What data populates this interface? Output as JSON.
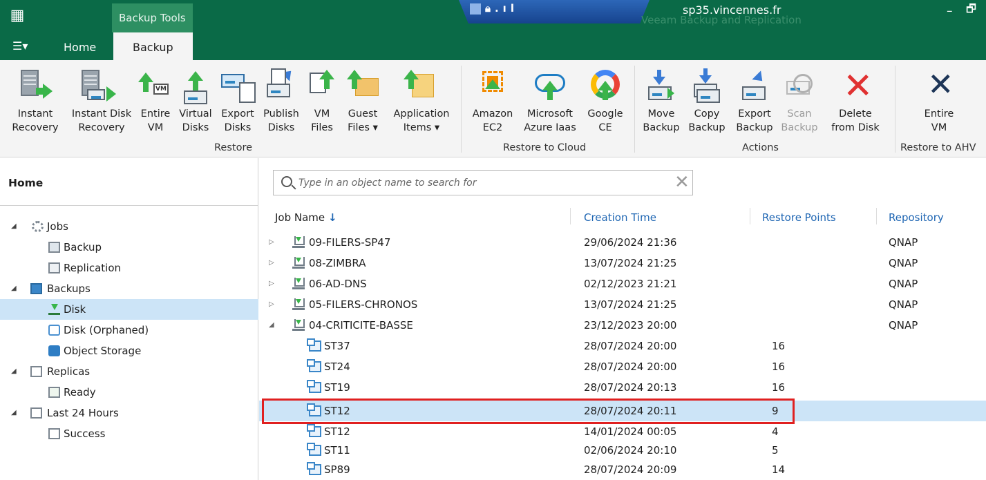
{
  "titlebar": {
    "contextual_tab": "Backup Tools",
    "ghost_title": "Veeam Backup and Replication",
    "server": "sp35.vincennes.fr",
    "minimize": "–",
    "restore": "🗗"
  },
  "tabs": {
    "menu": "☰▾",
    "home": "Home",
    "backup": "Backup"
  },
  "ribbon": {
    "buttons": [
      {
        "label": "Instant\nRecovery",
        "icon": "server-arrow-icon"
      },
      {
        "label": "Instant Disk\nRecovery",
        "icon": "server-disk-arrow-icon"
      },
      {
        "label": "Entire\nVM",
        "icon": "vm-restore-icon"
      },
      {
        "label": "Virtual\nDisks",
        "icon": "virtual-disk-restore-icon"
      },
      {
        "label": "Export\nDisks",
        "icon": "export-disk-icon"
      },
      {
        "label": "Publish\nDisks",
        "icon": "publish-disk-icon"
      },
      {
        "label": "VM\nFiles",
        "icon": "vm-files-icon"
      },
      {
        "label": "Guest\nFiles ▾",
        "icon": "guest-files-icon"
      },
      {
        "label": "Application\nItems ▾",
        "icon": "application-items-icon"
      },
      {
        "label": "Amazon\nEC2",
        "icon": "amazon-ec2-icon"
      },
      {
        "label": "Microsoft\nAzure Iaas",
        "icon": "azure-icon"
      },
      {
        "label": "Google\nCE",
        "icon": "google-ce-icon"
      },
      {
        "label": "Move\nBackup",
        "icon": "move-backup-icon"
      },
      {
        "label": "Copy\nBackup",
        "icon": "copy-backup-icon"
      },
      {
        "label": "Export\nBackup",
        "icon": "export-backup-icon"
      },
      {
        "label": "Scan\nBackup",
        "icon": "scan-backup-icon",
        "disabled": true
      },
      {
        "label": "Delete\nfrom Disk",
        "icon": "delete-icon"
      },
      {
        "label": "Entire\nVM",
        "icon": "ahv-entire-vm-icon"
      }
    ],
    "groups": {
      "restore": "Restore",
      "restore_cloud": "Restore to Cloud",
      "actions": "Actions",
      "restore_ahv": "Restore to AHV"
    }
  },
  "left_panel": {
    "title": "Home",
    "tree": [
      {
        "label": "Jobs",
        "expander": "◢",
        "icon": "jobs-gear-icon"
      },
      {
        "label": "Backup",
        "icon": "backup-job-icon"
      },
      {
        "label": "Replication",
        "icon": "replication-job-icon"
      },
      {
        "label": "Backups",
        "expander": "◢",
        "icon": "backups-icon"
      },
      {
        "label": "Disk",
        "icon": "disk-icon",
        "selected": true
      },
      {
        "label": "Disk (Orphaned)",
        "icon": "disk-orphaned-icon"
      },
      {
        "label": "Object Storage",
        "icon": "object-storage-icon"
      },
      {
        "label": "Replicas",
        "expander": "◢",
        "icon": "replicas-icon"
      },
      {
        "label": "Ready",
        "icon": "ready-icon"
      },
      {
        "label": "Last 24 Hours",
        "expander": "◢",
        "icon": "last-24-hours-icon"
      },
      {
        "label": "Success",
        "icon": "success-icon"
      }
    ]
  },
  "search": {
    "placeholder": "Type in an object name to search for",
    "value": "",
    "clear": "✕"
  },
  "table": {
    "columns": [
      "Job Name",
      "Creation Time",
      "Restore Points",
      "Repository"
    ],
    "sort_arrow": "↓",
    "rows": [
      {
        "expander": "▷",
        "name": "09-FILERS-SP47",
        "time": "29/06/2024 21:36",
        "points": "",
        "repo": "QNAP",
        "kind": "job"
      },
      {
        "expander": "▷",
        "name": "08-ZIMBRA",
        "time": "13/07/2024 21:25",
        "points": "",
        "repo": "QNAP",
        "kind": "job"
      },
      {
        "expander": "▷",
        "name": "06-AD-DNS",
        "time": "02/12/2023 21:21",
        "points": "",
        "repo": "QNAP",
        "kind": "job"
      },
      {
        "expander": "▷",
        "name": "05-FILERS-CHRONOS",
        "time": "13/07/2024 21:25",
        "points": "",
        "repo": "QNAP",
        "kind": "job"
      },
      {
        "expander": "◢",
        "name": "04-CRITICITE-BASSE",
        "time": "23/12/2023 20:00",
        "points": "",
        "repo": "QNAP",
        "kind": "job"
      },
      {
        "expander": "",
        "name": "ST37",
        "time": "28/07/2024 20:00",
        "points": "16",
        "repo": "",
        "kind": "vm"
      },
      {
        "expander": "",
        "name": "ST24",
        "time": "28/07/2024 20:00",
        "points": "16",
        "repo": "",
        "kind": "vm"
      },
      {
        "expander": "",
        "name": "ST19",
        "time": "28/07/2024 20:13",
        "points": "16",
        "repo": "",
        "kind": "vm"
      },
      {
        "expander": "",
        "name": "ST12",
        "time": "28/07/2024 20:11",
        "points": "9",
        "repo": "",
        "kind": "vm",
        "selected": true
      },
      {
        "expander": "",
        "name": "ST12",
        "time": "14/01/2024 00:05",
        "points": "4",
        "repo": "",
        "kind": "vm"
      },
      {
        "expander": "",
        "name": "ST11",
        "time": "02/06/2024 20:10",
        "points": "5",
        "repo": "",
        "kind": "vm"
      },
      {
        "expander": "",
        "name": "SP89",
        "time": "28/07/2024 20:09",
        "points": "14",
        "repo": "",
        "kind": "vm"
      }
    ]
  }
}
